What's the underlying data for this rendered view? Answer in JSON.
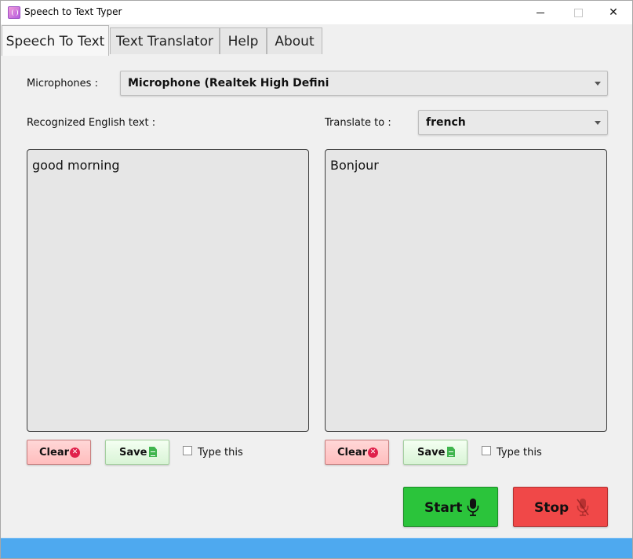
{
  "window": {
    "title": "Speech to Text Typer"
  },
  "tabs": [
    {
      "label": "Speech To Text"
    },
    {
      "label": "Text Translator"
    },
    {
      "label": "Help"
    },
    {
      "label": "About"
    }
  ],
  "microphones": {
    "label": "Microphones :",
    "selected": "Microphone (Realtek High Defini"
  },
  "recognized": {
    "label": "Recognized English text :",
    "text": "good morning"
  },
  "translate": {
    "label": "Translate to :",
    "selected": "french",
    "text": "Bonjour"
  },
  "left_controls": {
    "clear": "Clear",
    "save": "Save",
    "type_this": "Type this"
  },
  "right_controls": {
    "clear": "Clear",
    "save": "Save",
    "type_this": "Type this"
  },
  "actions": {
    "start": "Start",
    "stop": "Stop"
  },
  "colors": {
    "start": "#2bc43b",
    "stop": "#f04848",
    "status_bar": "#4ea9ef",
    "clear_icon": "#e0214b",
    "save_icon": "#3fb54d"
  },
  "icons": {
    "app": "app-icon",
    "clear": "close-circle-icon",
    "save": "document-icon",
    "start": "microphone-icon",
    "stop": "microphone-muted-icon"
  }
}
